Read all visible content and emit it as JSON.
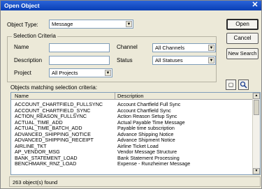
{
  "window": {
    "title": "Open Object",
    "close_glyph": "✕"
  },
  "form": {
    "object_type_label": "Object Type:",
    "object_type_value": "Message",
    "criteria_legend": "Selection Criteria",
    "name_label": "Name",
    "description_label": "Description",
    "project_label": "Project",
    "project_value": "All Projects",
    "channel_label": "Channel",
    "channel_value": "All Channels",
    "status_label": "Status",
    "status_value": "All Statuses",
    "name_value": "",
    "description_value": ""
  },
  "buttons": {
    "open": "Open",
    "cancel": "Cancel",
    "new_search": "New Search"
  },
  "list": {
    "caption": "Objects matching selection criteria:",
    "columns": [
      "Name",
      "Description"
    ],
    "rows": [
      [
        "ACCOUNT_CHARTFIELD_FULLSYNC",
        "Account Chartfield Full Sync"
      ],
      [
        "ACCOUNT_CHARTFIELD_SYNC",
        "Account Chartfield Sync"
      ],
      [
        "ACTION_REASON_FULLSYNC",
        "Action Reason Setup Sync"
      ],
      [
        "ACTUAL_TIME_ADD",
        "Actual Payable Time Message"
      ],
      [
        "ACTUAL_TIME_BATCH_ADD",
        "Payable time subscription"
      ],
      [
        "ADVANCED_SHIPPING_NOTICE",
        "Advance Shipping Notice"
      ],
      [
        "ADVANCED_SHIPPING_RECEIPT",
        "Advance Shipment Notice"
      ],
      [
        "AIRLINE_TKT",
        "Airline Ticket Load"
      ],
      [
        "AP_VENDOR_MSG",
        "Vendor Message Structure"
      ],
      [
        "BANK_STATEMENT_LOAD",
        "Bank Statement Processing"
      ],
      [
        "BENCHMARK_RNZ_LOAD",
        "Expense - Runzheimer Message"
      ]
    ]
  },
  "status": {
    "count_text": "263 object(s) found"
  },
  "icons": {
    "dropdown": "▼",
    "scroll_up": "▲",
    "scroll_down": "▼",
    "view_icon": "▢",
    "search_icon": "🔍"
  }
}
